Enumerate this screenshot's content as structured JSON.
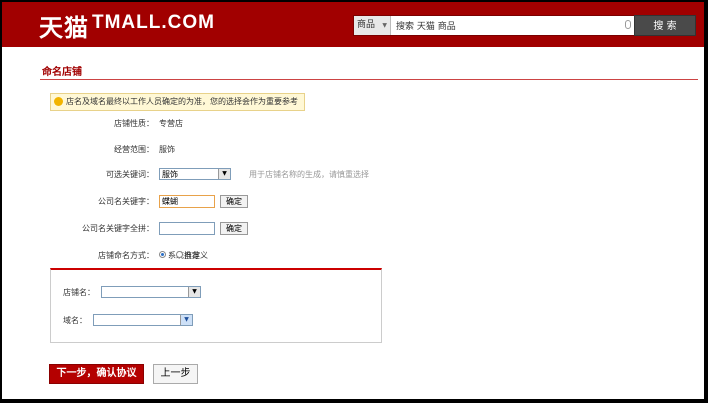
{
  "header": {
    "logo_cn": "天猫",
    "logo_en": "TMALL.COM",
    "search_scope": "商品",
    "search_value": "搜索 天猫 商品",
    "search_button": "搜 索"
  },
  "page": {
    "title": "命名店铺",
    "tip": "店名及域名最终以工作人员确定的为准，您的选择会作为重要参考"
  },
  "form": {
    "store_type_label": "店铺性质：",
    "store_type_value": "专营店",
    "scope_label": "经营范围：",
    "scope_value": "服饰",
    "keyword_label": "可选关键词：",
    "keyword_selected": "服饰",
    "keyword_hint": "用于店铺名称的生成，请慎重选择",
    "company_keyword_label": "公司名关键字：",
    "company_keyword_value": "蝶蝴",
    "confirm_label": "确定",
    "company_pinyin_label": "公司名关键字全拼：",
    "company_pinyin_value": "",
    "naming_label": "店铺命名方式：",
    "naming_opt_system": "系统推荐",
    "naming_opt_custom": "自定义",
    "store_name_label": "店铺名：",
    "store_name_value": "",
    "domain_label": "域名：",
    "domain_value": ""
  },
  "actions": {
    "next": "下一步，确认协议",
    "prev": "上一步"
  }
}
